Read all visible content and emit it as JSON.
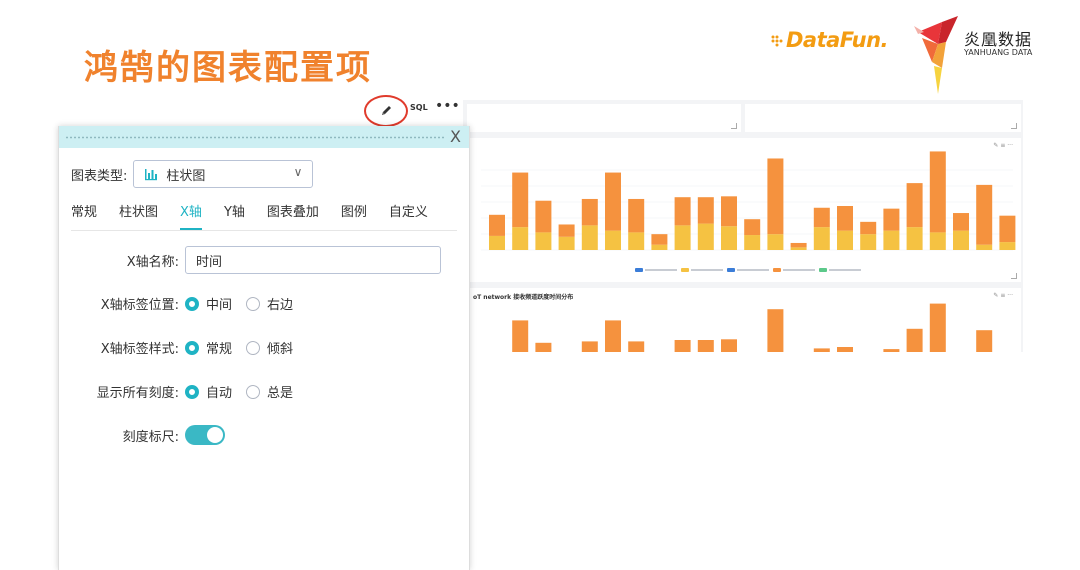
{
  "slide": {
    "title": "鸿鹄的图表配置项"
  },
  "logos": {
    "datafun": "DataFun.",
    "yanhuang_cn": "炎凰数据",
    "yanhuang_en": "YANHUANG DATA"
  },
  "edit_controls": {
    "pencil_icon": "pencil-icon",
    "sql_label": "SQL",
    "more_label": "•••"
  },
  "background_dashboard": {
    "chart2_title": "oT network 接收频道跃度时间分布",
    "chart1_bars": [
      {
        "orange": 0.24,
        "yellow": 0.16
      },
      {
        "orange": 0.62,
        "yellow": 0.26
      },
      {
        "orange": 0.36,
        "yellow": 0.2
      },
      {
        "orange": 0.14,
        "yellow": 0.15
      },
      {
        "orange": 0.3,
        "yellow": 0.28
      },
      {
        "orange": 0.66,
        "yellow": 0.22
      },
      {
        "orange": 0.38,
        "yellow": 0.2
      },
      {
        "orange": 0.12,
        "yellow": 0.06
      },
      {
        "orange": 0.32,
        "yellow": 0.28
      },
      {
        "orange": 0.3,
        "yellow": 0.3
      },
      {
        "orange": 0.34,
        "yellow": 0.27
      },
      {
        "orange": 0.18,
        "yellow": 0.17
      },
      {
        "orange": 0.86,
        "yellow": 0.18
      },
      {
        "orange": 0.05,
        "yellow": 0.03
      },
      {
        "orange": 0.22,
        "yellow": 0.26
      },
      {
        "orange": 0.28,
        "yellow": 0.22
      },
      {
        "orange": 0.14,
        "yellow": 0.18
      },
      {
        "orange": 0.25,
        "yellow": 0.22
      },
      {
        "orange": 0.5,
        "yellow": 0.26
      },
      {
        "orange": 0.92,
        "yellow": 0.2
      },
      {
        "orange": 0.2,
        "yellow": 0.22
      },
      {
        "orange": 0.68,
        "yellow": 0.06
      },
      {
        "orange": 0.3,
        "yellow": 0.09
      }
    ],
    "colors": {
      "orange": "#f5923e",
      "yellow": "#f5c242",
      "blue": "#3b7dd8",
      "green": "#5cc98a"
    }
  },
  "panel": {
    "close_label": "X",
    "chart_type_label": "图表类型:",
    "chart_type_value": "柱状图",
    "tabs": [
      "常规",
      "柱状图",
      "X轴",
      "Y轴",
      "图表叠加",
      "图例",
      "自定义"
    ],
    "active_tab": "X轴",
    "x_axis_name_label": "X轴名称:",
    "x_axis_name_value": "时间",
    "label_position_label": "X轴标签位置:",
    "label_position_options": [
      "中间",
      "右边"
    ],
    "label_style_label": "X轴标签样式:",
    "label_style_options": [
      "常规",
      "倾斜"
    ],
    "show_ticks_label": "显示所有刻度:",
    "show_ticks_options": [
      "自动",
      "总是"
    ],
    "tick_ruler_label": "刻度标尺:",
    "tick_ruler_on": true
  },
  "accent_color": "#1fb3c4",
  "title_color": "#f0822d"
}
